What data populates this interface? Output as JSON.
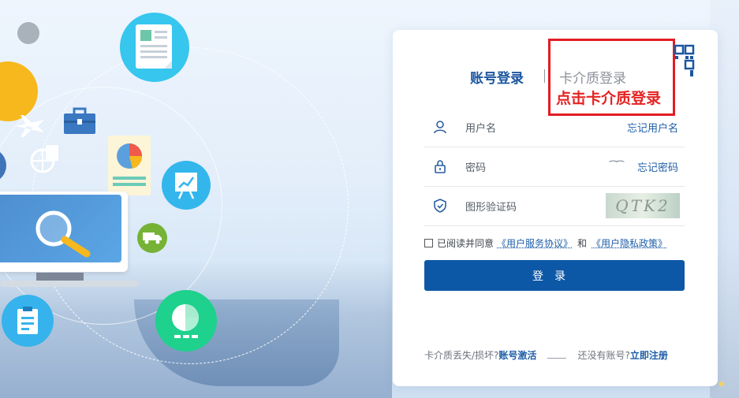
{
  "tabs": {
    "account_login": "账号登录",
    "card_login": "卡介质登录",
    "card_login_hint": "点击卡介质登录"
  },
  "form": {
    "username_label": "用户名",
    "forgot_username": "忘记用户名",
    "password_label": "密码",
    "password_eye": "⁀⁀",
    "forgot_password": "忘记密码",
    "captcha_label": "图形验证码",
    "captcha_text": "QTK2"
  },
  "agreement": {
    "prefix": "已阅读并同意",
    "service_link": "《用户服务协议》",
    "and": "和",
    "privacy_link": "《用户隐私政策》"
  },
  "login_button": "登录",
  "footer": {
    "lost_card_text": "卡介质丢失/损坏?",
    "activate_link": "账号激活",
    "no_account_text": "还没有账号?",
    "register_link": "立即注册"
  },
  "colors": {
    "accent": "#0d58a6",
    "highlight_box": "#e21c24"
  },
  "icons": [
    "user-icon",
    "lock-icon",
    "shield-icon",
    "qr-code-icon"
  ]
}
